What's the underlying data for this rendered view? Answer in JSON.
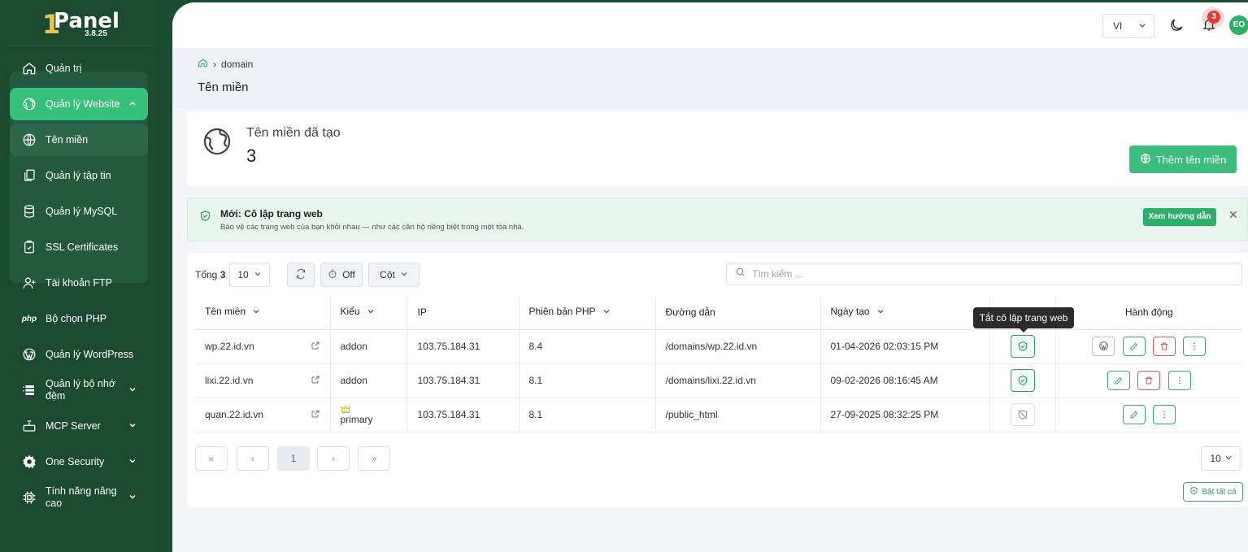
{
  "app": {
    "logo_text": "Panel",
    "logo_one": "1",
    "version": "3.8.25"
  },
  "sidebar": {
    "items": [
      {
        "name": "admin",
        "label": "Quản trị",
        "icon": "home-icon"
      },
      {
        "name": "website-management",
        "label": "Quản lý Website",
        "icon": "globe-icon",
        "active": true,
        "expanded": true
      },
      {
        "name": "domains",
        "label": "Tên miền",
        "icon": "globe-icon",
        "sub": true,
        "active": true
      },
      {
        "name": "file-manager",
        "label": "Quản lý tập tin",
        "icon": "files-icon",
        "sub": true
      },
      {
        "name": "mysql",
        "label": "Quản lý MySQL",
        "icon": "database-icon",
        "sub": true
      },
      {
        "name": "ssl",
        "label": "SSL Certificates",
        "icon": "certificate-icon",
        "sub": true
      },
      {
        "name": "ftp",
        "label": "Tài khoản FTP",
        "icon": "user-plus-icon",
        "sub": true
      },
      {
        "name": "php-selector",
        "label": "Bộ chọn PHP",
        "icon": "php-icon",
        "sub": true
      },
      {
        "name": "wordpress",
        "label": "Quản lý WordPress",
        "icon": "wordpress-icon"
      },
      {
        "name": "cache",
        "label": "Quản lý bộ nhớ đệm",
        "icon": "server-stack-icon",
        "chevron": true
      },
      {
        "name": "mcp-server",
        "label": "MCP Server",
        "icon": "robot-icon",
        "chevron": true
      },
      {
        "name": "one-security",
        "label": "One Security",
        "icon": "gear-icon",
        "chevron": true
      },
      {
        "name": "advanced",
        "label": "Tính năng nâng cao",
        "icon": "chip-icon",
        "chevron": true
      }
    ]
  },
  "topbar": {
    "language": "VI",
    "notification_count": "3",
    "avatar_initials": "EO"
  },
  "breadcrumb": {
    "current": "domain"
  },
  "page_title": "Tên miền",
  "stat": {
    "label": "Tên miền đã tạo",
    "value": "3",
    "add_button": "Thêm tên miền"
  },
  "notice": {
    "title": "Mới: Cô lập trang web",
    "description": "Bảo vệ các trang web của bạn khỏi nhau — như các căn hộ riêng biệt trong một tòa nhà.",
    "guide_button": "Xem hướng dẫn",
    "close": "✕"
  },
  "toolbar": {
    "total_label": "Tổng",
    "total_value": "3",
    "page_size": "10",
    "auto_refresh": "Off",
    "columns": "Cột",
    "search_placeholder": "Tìm kiếm ..."
  },
  "table": {
    "headers": {
      "domain": "Tên miền",
      "type": "Kiểu",
      "ip": "IP",
      "php": "Phiên bản PHP",
      "path": "Đường dẫn",
      "created": "Ngày tạo",
      "actions": "Hành động"
    },
    "rows": [
      {
        "domain": "wp.22.id.vn",
        "type": "addon",
        "ip": "103.75.184.31",
        "php": "8.4",
        "path": "/domains/wp.22.id.vn",
        "created": "01-04-2026 02:03:15 PM"
      },
      {
        "domain": "lixi.22.id.vn",
        "type": "addon",
        "ip": "103.75.184.31",
        "php": "8.1",
        "path": "/domains/lixi.22.id.vn",
        "created": "09-02-2026 08:16:45 AM"
      },
      {
        "domain": "quan.22.id.vn",
        "type": "primary",
        "ip": "103.75.184.31",
        "php": "8.1",
        "path": "/public_html",
        "created": "27-09-2025 08:32:25 PM"
      }
    ]
  },
  "tooltip": "Tắt cô lập trang web",
  "pagination": {
    "first": "«",
    "prev": "‹",
    "current": "1",
    "next": "›",
    "last": "»",
    "page_size": "10"
  },
  "enable_all": "Bật tất cả",
  "colors": {
    "sidebar": "#1b4a31",
    "accent": "#36c07a",
    "danger": "#e05555"
  }
}
